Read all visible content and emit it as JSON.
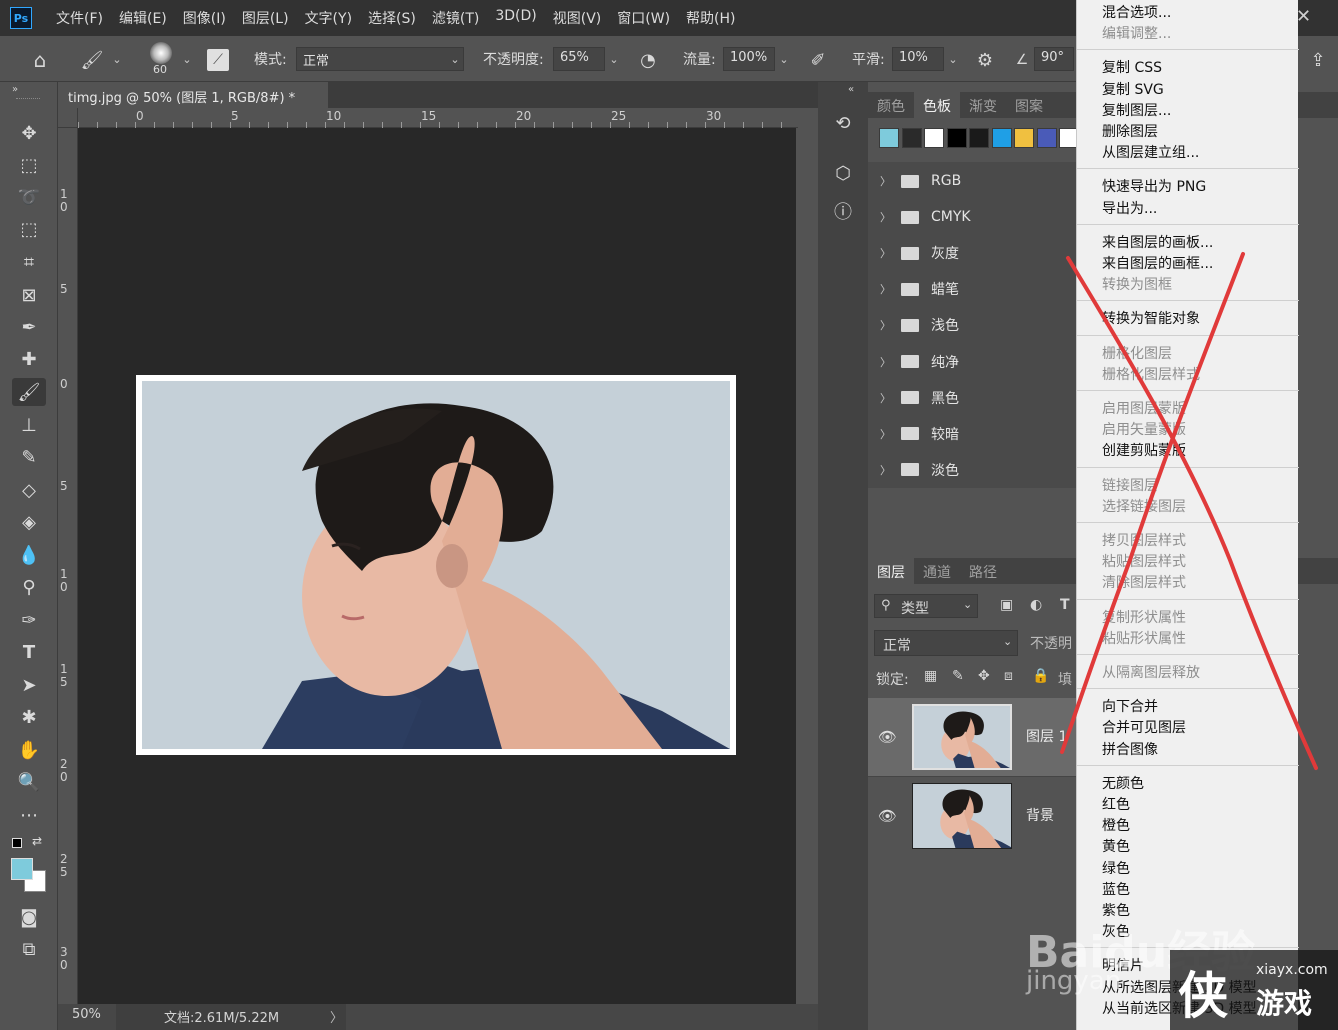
{
  "menubar": {
    "logo": "Ps",
    "items": [
      "文件(F)",
      "编辑(E)",
      "图像(I)",
      "图层(L)",
      "文字(Y)",
      "选择(S)",
      "滤镜(T)",
      "3D(D)",
      "视图(V)",
      "窗口(W)",
      "帮助(H)"
    ]
  },
  "options": {
    "brush_size": "60",
    "mode_label": "模式:",
    "mode_value": "正常",
    "opacity_label": "不透明度:",
    "opacity_value": "65%",
    "flow_label": "流量:",
    "flow_value": "100%",
    "smooth_label": "平滑:",
    "smooth_value": "10%",
    "angle_value": "90°"
  },
  "document": {
    "tab_title": "timg.jpg @ 50% (图层 1, RGB/8#) *",
    "close_glyph": "×",
    "ruler_h": [
      "0",
      "5",
      "10",
      "15",
      "20",
      "25",
      "30"
    ],
    "ruler_v": [
      "1\n0",
      "5",
      "0",
      "5",
      "1\n0",
      "1\n5",
      "2\n0",
      "2\n5",
      "3\n0"
    ],
    "zoom": "50%",
    "doc_info": "文档:2.61M/5.22M",
    "doc_info_arrow": "〉"
  },
  "swatches_panel": {
    "tabs": [
      "颜色",
      "色板",
      "渐变",
      "图案"
    ],
    "active_tab": "色板",
    "swatch_colors": [
      "#7ecbdc",
      "#2a2a2a",
      "#ffffff",
      "#000000",
      "#1a1a1a",
      "#1f9fe6",
      "#f0c040",
      "#4a5bb8",
      "#ffffff"
    ],
    "groups": [
      "RGB",
      "CMYK",
      "灰度",
      "蜡笔",
      "浅色",
      "纯净",
      "黑色",
      "较暗",
      "淡色"
    ]
  },
  "layers_panel": {
    "tabs": [
      "图层",
      "通道",
      "路径"
    ],
    "active_tab": "图层",
    "filter_label": "类型",
    "blend_mode": "正常",
    "opacity_label": "不透明",
    "lock_label": "锁定:",
    "fill_label": "填",
    "layers": [
      {
        "name": "图层 1",
        "selected": true
      },
      {
        "name": "背景",
        "selected": false
      }
    ]
  },
  "context_menu": {
    "groups": [
      [
        {
          "label": "混合选项...",
          "disabled": false
        },
        {
          "label": "编辑调整...",
          "disabled": true
        }
      ],
      [
        {
          "label": "复制 CSS",
          "disabled": false
        },
        {
          "label": "复制 SVG",
          "disabled": false
        },
        {
          "label": "复制图层...",
          "disabled": false
        },
        {
          "label": "删除图层",
          "disabled": false
        },
        {
          "label": "从图层建立组...",
          "disabled": false
        }
      ],
      [
        {
          "label": "快速导出为 PNG",
          "disabled": false
        },
        {
          "label": "导出为...",
          "disabled": false
        }
      ],
      [
        {
          "label": "来自图层的画板...",
          "disabled": false
        },
        {
          "label": "来自图层的画框...",
          "disabled": false
        },
        {
          "label": "转换为图框",
          "disabled": true
        }
      ],
      [
        {
          "label": "转换为智能对象",
          "disabled": false
        }
      ],
      [
        {
          "label": "栅格化图层",
          "disabled": true
        },
        {
          "label": "栅格化图层样式",
          "disabled": true
        }
      ],
      [
        {
          "label": "启用图层蒙版",
          "disabled": true
        },
        {
          "label": "启用矢量蒙版",
          "disabled": true
        },
        {
          "label": "创建剪贴蒙版",
          "disabled": false
        }
      ],
      [
        {
          "label": "链接图层",
          "disabled": true
        },
        {
          "label": "选择链接图层",
          "disabled": true
        }
      ],
      [
        {
          "label": "拷贝图层样式",
          "disabled": true
        },
        {
          "label": "粘贴图层样式",
          "disabled": true
        },
        {
          "label": "清除图层样式",
          "disabled": true
        }
      ],
      [
        {
          "label": "复制形状属性",
          "disabled": true
        },
        {
          "label": "粘贴形状属性",
          "disabled": true
        }
      ],
      [
        {
          "label": "从隔离图层释放",
          "disabled": true
        }
      ],
      [
        {
          "label": "向下合并",
          "disabled": false
        },
        {
          "label": "合并可见图层",
          "disabled": false
        },
        {
          "label": "拼合图像",
          "disabled": false
        }
      ],
      [
        {
          "label": "无颜色",
          "disabled": false
        },
        {
          "label": "红色",
          "disabled": false
        },
        {
          "label": "橙色",
          "disabled": false
        },
        {
          "label": "黄色",
          "disabled": false
        },
        {
          "label": "绿色",
          "disabled": false
        },
        {
          "label": "蓝色",
          "disabled": false
        },
        {
          "label": "紫色",
          "disabled": false
        },
        {
          "label": "灰色",
          "disabled": false
        }
      ],
      [
        {
          "label": "明信片",
          "disabled": false
        },
        {
          "label": "从所选图层新建 3D 模型",
          "disabled": false
        },
        {
          "label": "从当前选区新建 3D 模型",
          "disabled": false
        }
      ]
    ]
  },
  "watermarks": {
    "baidu_text": "Baidu经验",
    "baidu_sub": "jingyan",
    "site": "xiayx.com",
    "game": "游戏",
    "game_glyph": "侠"
  },
  "colors": {
    "menubar_bg": "#323232",
    "panel_bg": "#535353",
    "canvas_bg": "#282828",
    "red_cross": "#e03030",
    "foreground_color": "#7ecbdc",
    "background_color": "#ffffff"
  },
  "icons": [
    "home-icon",
    "brush-icon",
    "move-icon",
    "marquee-icon",
    "lasso-icon",
    "crop-icon",
    "eyedropper-icon",
    "text-icon",
    "hand-icon",
    "zoom-icon",
    "eye-icon",
    "settings-icon",
    "share-icon"
  ]
}
